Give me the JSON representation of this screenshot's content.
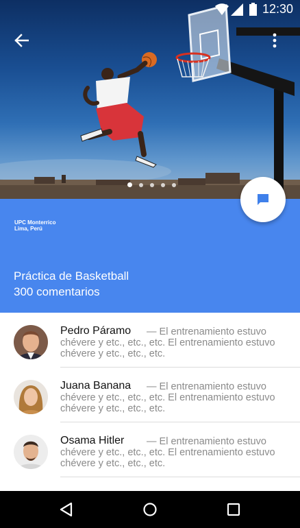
{
  "status_bar": {
    "time": "12:30"
  },
  "hero": {
    "carousel_pages": 5,
    "carousel_active_index": 0
  },
  "header": {
    "location_line1": "UPC Monterrico",
    "location_line2": "Lima, Perú",
    "title": "Práctica de Basketball",
    "subtitle": "300 comentarios"
  },
  "colors": {
    "accent": "#4886ee",
    "fab_icon": "#3f80ea"
  },
  "icons": {
    "back": "arrow-back-icon",
    "overflow": "more-vert-icon",
    "fab": "chat-bubble-icon",
    "nav_back": "triangle-back-icon",
    "nav_home": "circle-home-icon",
    "nav_recents": "square-recents-icon"
  },
  "comments": [
    {
      "name": "Pedro Páramo",
      "snippet_first": "— El entrenamiento estuvo",
      "snippet_rest": "chévere y etc., etc., etc. El entrenamiento estuvo chévere y etc., etc., etc."
    },
    {
      "name": "Juana Banana",
      "snippet_first": "— El entrenamiento estuvo",
      "snippet_rest": "chévere y etc., etc., etc. El entrenamiento estuvo chévere y etc., etc., etc."
    },
    {
      "name": "Osama Hitler",
      "snippet_first": "— El entrenamiento estuvo",
      "snippet_rest": "chévere y etc., etc., etc. El entrenamiento estuvo chévere y etc., etc., etc."
    }
  ]
}
